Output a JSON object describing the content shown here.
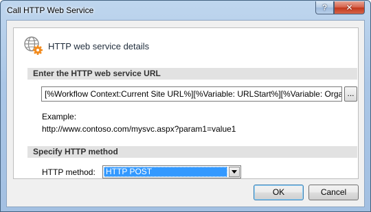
{
  "window": {
    "title": "Call HTTP Web Service"
  },
  "titlebar": {
    "help_glyph": "?",
    "close_glyph": "✕"
  },
  "panel": {
    "title": "HTTP web service details",
    "icon": "globe-gear-icon",
    "url_section": {
      "header": "Enter the HTTP web service URL",
      "url_value": "[%Workflow Context:Current Site URL%][%Variable: URLStart%][%Variable: Organi",
      "browse_label": "...",
      "example_label": "Example:",
      "example_url": "http://www.contoso.com/mysvc.aspx?param1=value1"
    },
    "method_section": {
      "header": "Specify HTTP method",
      "label": "HTTP method:",
      "selected": "HTTP POST"
    }
  },
  "buttons": {
    "ok": "OK",
    "cancel": "Cancel"
  },
  "colors": {
    "selection": "#3399ff",
    "section_header_bg": "#e2e2e2",
    "close_button": "#c7422a"
  }
}
